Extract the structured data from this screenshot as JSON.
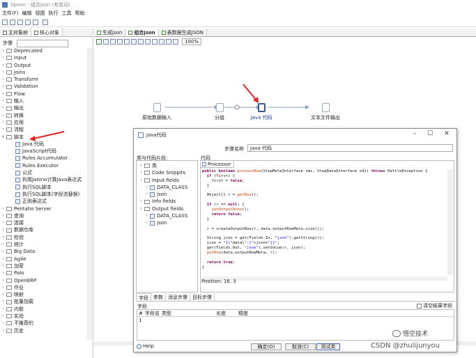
{
  "app": {
    "title": "Spoon - 组合json (有变动)"
  },
  "menu": [
    "文件(F)",
    "编辑",
    "视图",
    "执行",
    "工具",
    "帮助"
  ],
  "left_tabs": [
    "主对象树",
    "核心对象"
  ],
  "search_label": "步骤",
  "tree": [
    {
      "label": "Deprecated",
      "expanded": false
    },
    {
      "label": "Input",
      "expanded": false
    },
    {
      "label": "Output",
      "expanded": false
    },
    {
      "label": "Joins",
      "expanded": false
    },
    {
      "label": "Transform",
      "expanded": false
    },
    {
      "label": "Validation",
      "expanded": false
    },
    {
      "label": "Flow",
      "expanded": false
    },
    {
      "label": "输入",
      "expanded": false
    },
    {
      "label": "输出",
      "expanded": false
    },
    {
      "label": "转换",
      "expanded": false
    },
    {
      "label": "应用",
      "expanded": false
    },
    {
      "label": "流程",
      "expanded": false
    },
    {
      "label": "脚本",
      "expanded": true,
      "children": [
        "Java 代码",
        "JavaScript代码",
        "Rules Accumulator",
        "Rules Executor",
        "公式",
        "利用Janino计算Java表达式",
        "执行SQL脚本",
        "执行SQL脚本(字段流替换)",
        "正则表达式"
      ]
    },
    {
      "label": "Pentaho Server",
      "expanded": false
    },
    {
      "label": "查询",
      "expanded": false
    },
    {
      "label": "连接",
      "expanded": false
    },
    {
      "label": "数据仓库",
      "expanded": false
    },
    {
      "label": "检验",
      "expanded": false
    },
    {
      "label": "统计",
      "expanded": false
    },
    {
      "label": "Big Data",
      "expanded": false
    },
    {
      "label": "Agile",
      "expanded": false
    },
    {
      "label": "加密",
      "expanded": false
    },
    {
      "label": "Palo",
      "expanded": false
    },
    {
      "label": "OpenERP",
      "expanded": false
    },
    {
      "label": "作业",
      "expanded": false
    },
    {
      "label": "映射",
      "expanded": false
    },
    {
      "label": "批量加载",
      "expanded": false
    },
    {
      "label": "内联",
      "expanded": false
    },
    {
      "label": "实验",
      "expanded": false
    },
    {
      "label": "不推荐的",
      "expanded": false
    },
    {
      "label": "历史",
      "expanded": false
    }
  ],
  "main_tabs": [
    {
      "label": "生成json",
      "active": false
    },
    {
      "label": "组合json",
      "active": true
    },
    {
      "label": "表数据生成JSON",
      "active": false
    }
  ],
  "zoom": "100%",
  "steps": [
    {
      "label": "原始数据输入"
    },
    {
      "label": "分组"
    },
    {
      "label": "Java 代码"
    },
    {
      "label": "文本文件输出"
    }
  ],
  "dialog": {
    "title": "Java代码",
    "step_name_label": "步骤名称",
    "step_name_value": "Java 代码",
    "snippets_label": "类与代码片段:",
    "code_label": "代码",
    "snippet_tree": [
      {
        "label": "类",
        "level": 0
      },
      {
        "label": "Code Snippits",
        "level": 0
      },
      {
        "label": "Input fields",
        "level": 0
      },
      {
        "label": "DATA_CLASS",
        "level": 1
      },
      {
        "label": "json",
        "level": 1
      },
      {
        "label": "Info fields",
        "level": 0
      },
      {
        "label": "Output fields",
        "level": 0
      },
      {
        "label": "DATA_CLASS",
        "level": 1
      },
      {
        "label": "json",
        "level": 1
      }
    ],
    "editor_tab": "Processor",
    "code_lines": [
      "public boolean processRow(StepMetaInterface smi, StepDataInterface sdi) throws KettleException {",
      "  if (first) {",
      "    first = false;",
      "  }",
      "",
      "  Object[] r = getRow();",
      "",
      "  if (r == null) {",
      "    setOutputDone();",
      "    return false;",
      "  }",
      "",
      "  r = createOutputRow(r, data.outputRowMeta.size());",
      "",
      "  String json = get(Fields.In, \"json\").getString(r);",
      "  json = \"{\\\"data\\\":[\"+json+\"]}\";",
      "  get(Fields.Out, \"json\").setValue(r, json);",
      "  putRow(data.outputRowMeta, r);",
      "",
      "  return true;",
      "}"
    ],
    "position": "Position: 16, 3",
    "bottom_tabs": [
      "字段",
      "参数",
      "消息步骤",
      "目标步骤"
    ],
    "fields_label": "字段",
    "clear_label": "清空结果字段",
    "table_headers": [
      "#",
      "字段名",
      "类型",
      "长度",
      "精度"
    ],
    "table_rows": [
      [
        "1",
        "",
        "",
        "",
        ""
      ]
    ],
    "help": "Help",
    "ok": "确定(O)",
    "cancel": "取消(C)",
    "test": "测试类"
  },
  "watermark": {
    "brand": "悟空技术",
    "csdn": "CSDN @zhulijunyou"
  }
}
